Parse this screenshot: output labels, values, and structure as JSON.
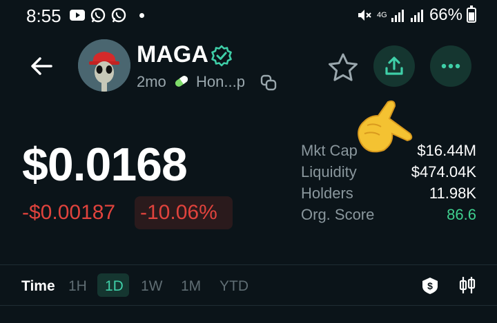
{
  "status_bar": {
    "time": "8:55",
    "battery": "66%",
    "battery_level": 0.66,
    "network": "4G"
  },
  "token": {
    "name": "MAGA",
    "age": "2mo",
    "launchpad": "Hon...p",
    "verified": true
  },
  "price": {
    "value": "$0.0168",
    "change_abs": "-$0.00187",
    "change_pct": "-10.06%"
  },
  "stats": [
    {
      "label": "Mkt Cap",
      "value": "$16.44M"
    },
    {
      "label": "Liquidity",
      "value": "$474.04K"
    },
    {
      "label": "Holders",
      "value": "11.98K"
    },
    {
      "label": "Org. Score",
      "value": "86.6"
    }
  ],
  "timeframes": {
    "label": "Time",
    "options": [
      "1H",
      "1D",
      "1W",
      "1M",
      "YTD"
    ],
    "selected": "1D"
  },
  "colors": {
    "background": "#0b1419",
    "accent": "#3fcfa8",
    "negative": "#e0433d",
    "positive": "#3fcf8e"
  }
}
